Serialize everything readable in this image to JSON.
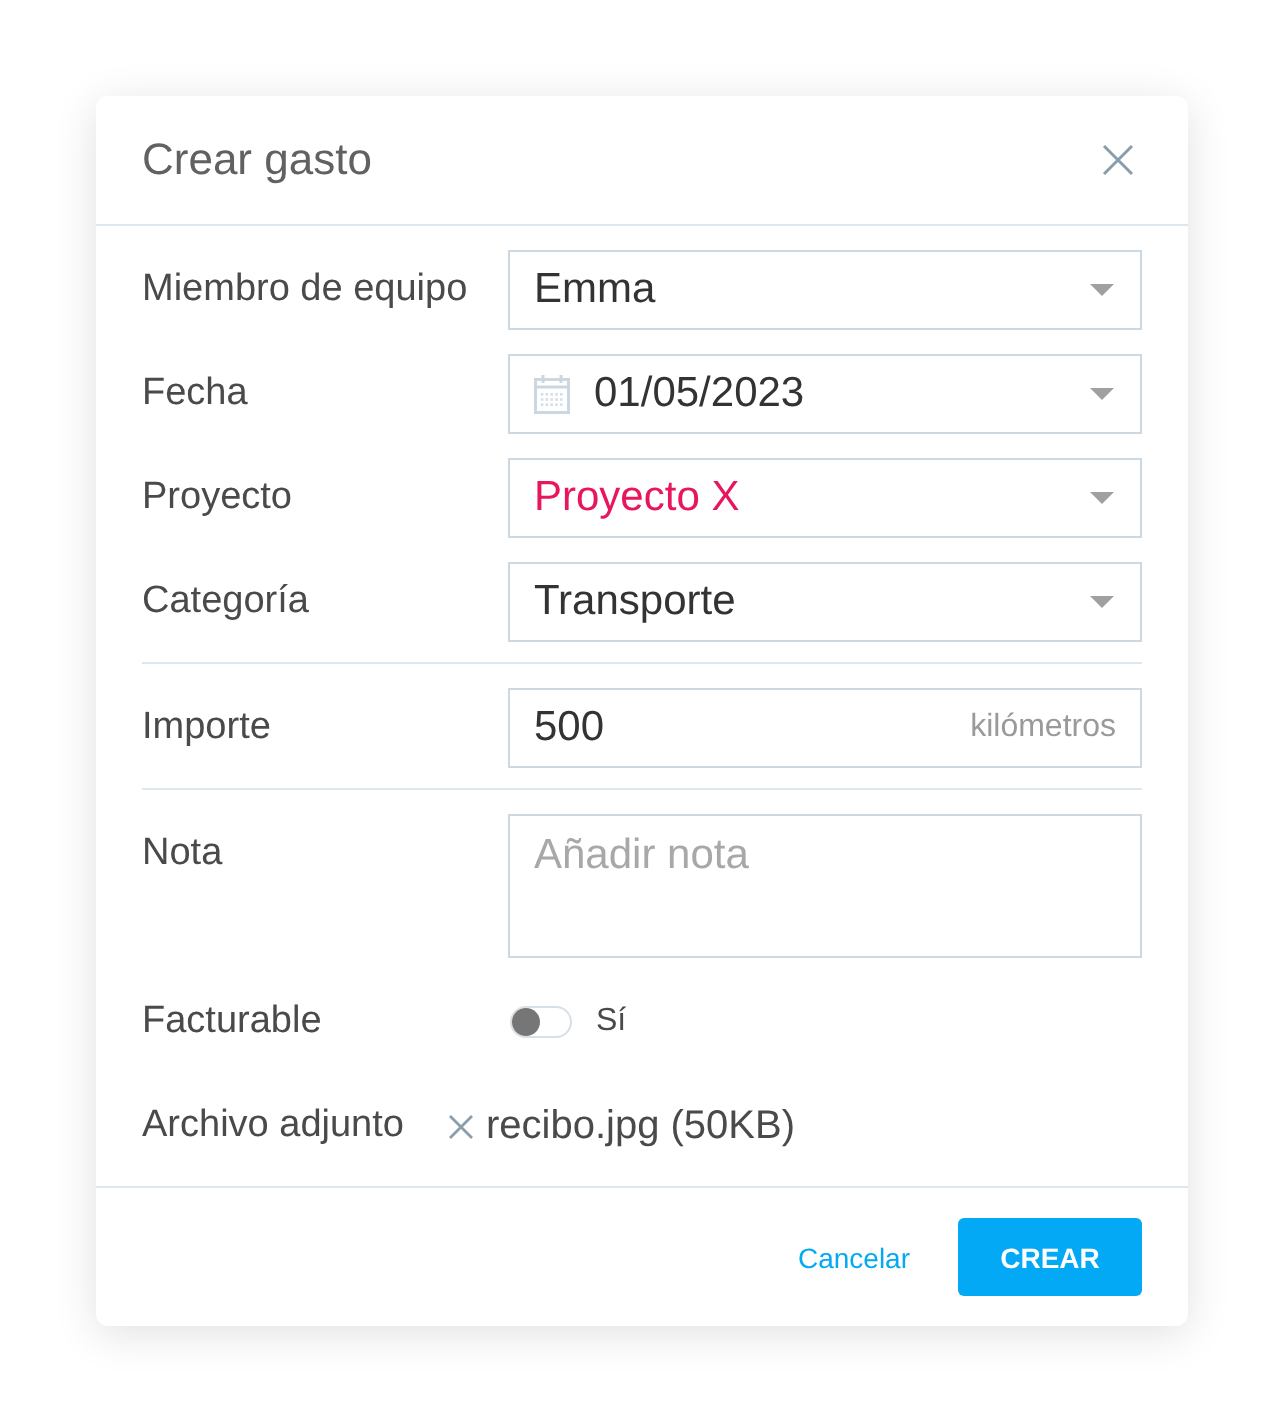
{
  "dialog": {
    "title": "Crear gasto"
  },
  "groups": [
    {
      "fields": [
        {
          "kind": "select",
          "label": "Miembro de equipo",
          "value": "Emma"
        },
        {
          "kind": "date",
          "label": "Fecha",
          "value": "01/05/2023"
        },
        {
          "kind": "select",
          "label": "Proyecto",
          "value": "Proyecto X",
          "color": "#e8175d"
        },
        {
          "kind": "select",
          "label": "Categoría",
          "value": "Transporte"
        }
      ]
    },
    {
      "fields": [
        {
          "kind": "amount",
          "label": "Importe",
          "value": "500",
          "unit": "kilómetros"
        }
      ]
    },
    {
      "fields": [
        {
          "kind": "textarea",
          "label": "Nota",
          "placeholder": "Añadir nota"
        },
        {
          "kind": "toggle",
          "label": "Facturable",
          "on": false,
          "text": "Sí"
        },
        {
          "kind": "attachment",
          "label": "Archivo adjunto",
          "file": "recibo.jpg (50KB)"
        }
      ]
    }
  ],
  "footer": {
    "buttons": [
      {
        "kind": "link",
        "label": "Cancelar"
      },
      {
        "kind": "primary",
        "label": "CREAR"
      }
    ]
  }
}
